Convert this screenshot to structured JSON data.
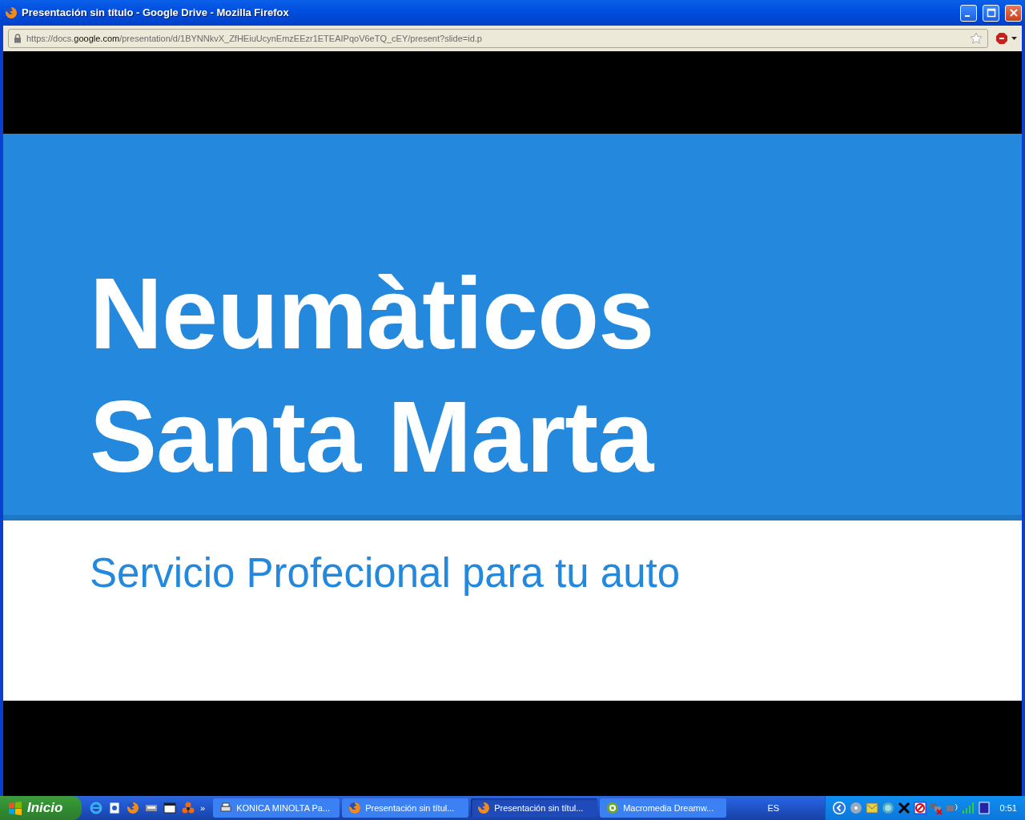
{
  "window": {
    "title": "Presentación sin título - Google Drive - Mozilla Firefox"
  },
  "address_bar": {
    "url_prefix": "https://docs.",
    "url_domain": "google.com",
    "url_path": "/presentation/d/1BYNNkvX_ZfHEiuUcynEmzEEzr1ETEAIPqoV6eTQ_cEY/present?slide=id.p",
    "bookmarked": false
  },
  "slide": {
    "title_lines": [
      "Neumàticos",
      "Santa Marta"
    ],
    "subtitle": "Servicio Profecional para tu auto"
  },
  "taskbar": {
    "start": "Inicio",
    "overflow": "»",
    "buttons": [
      {
        "label": "KONICA MINOLTA Pa...",
        "kind": "printer",
        "selected": false
      },
      {
        "label": "Presentación sin títul...",
        "kind": "firefox",
        "selected": false
      },
      {
        "label": "Presentación sin títul...",
        "kind": "firefox",
        "selected": true
      },
      {
        "label": "Macromedia Dreamw...",
        "kind": "dreamweaver",
        "selected": false
      }
    ],
    "language": "ES",
    "clock": "0:51"
  }
}
